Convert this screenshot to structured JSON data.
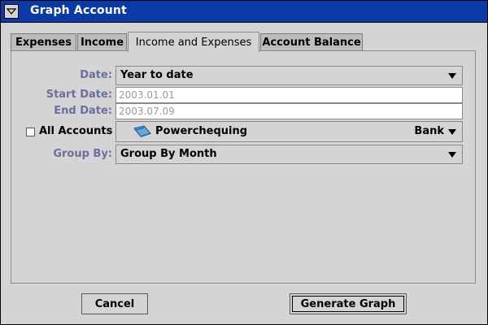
{
  "window": {
    "title": "Graph Account"
  },
  "tabs": [
    {
      "label": "Expenses"
    },
    {
      "label": "Income"
    },
    {
      "label": "Income and Expenses",
      "active": true
    },
    {
      "label": "Account Balance"
    }
  ],
  "form": {
    "date_label": "Date:",
    "date_value": "Year to date",
    "start_date_label": "Start Date:",
    "start_date_value": "2003.01.01",
    "end_date_label": "End Date:",
    "end_date_value": "2003.07.09",
    "all_accounts_label": "All Accounts",
    "all_accounts_checked": false,
    "account_name": "Powerchequing",
    "account_type": "Bank",
    "group_by_label": "Group By:",
    "group_by_value": "Group By Month"
  },
  "buttons": {
    "cancel": "Cancel",
    "generate": "Generate Graph"
  },
  "colors": {
    "titlebar": "#0a3aa8",
    "label": "#6b6f9e",
    "background": "#d4d4d4"
  }
}
